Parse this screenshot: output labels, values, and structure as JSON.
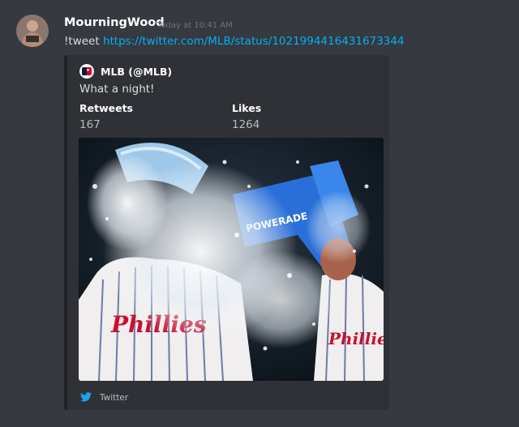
{
  "message": {
    "username": "MourningWood",
    "timestamp": "Today at 10:41 AM",
    "command": "!tweet",
    "link": "https://twitter.com/MLB/status/1021994416431673344"
  },
  "embed": {
    "author": "MLB (@MLB)",
    "description": "What a night!",
    "fields": [
      {
        "name": "Retweets",
        "value": "167"
      },
      {
        "name": "Likes",
        "value": "1264"
      }
    ],
    "footer": "Twitter",
    "image_text": {
      "cooler_brand": "POWERADE",
      "jersey_left": "Phillies",
      "jersey_right": "Phillies"
    }
  },
  "colors": {
    "background": "#36393f",
    "embed_background": "#2f3136",
    "link": "#00b0f4",
    "twitter_blue": "#1da1f2"
  },
  "icons": [
    "user-avatar",
    "mlb-logo-icon",
    "twitter-bird-icon"
  ]
}
